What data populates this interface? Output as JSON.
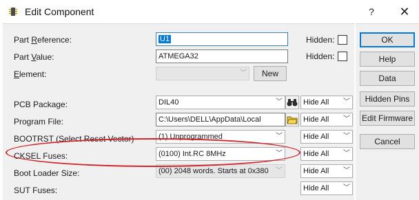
{
  "window": {
    "title": "Edit Component",
    "help_glyph": "?",
    "close_glyph": "✕"
  },
  "fields": [
    {
      "label_pre": "Part ",
      "label_key": "R",
      "label_post": "eference:",
      "value": "U1"
    },
    {
      "label_pre": "Part ",
      "label_key": "V",
      "label_post": "alue:",
      "value": "ATMEGA32"
    },
    {
      "label_pre": "",
      "label_key": "E",
      "label_post": "lement:",
      "value": ""
    }
  ],
  "hidden_label": "Hidden:",
  "new_button": "New",
  "properties": [
    {
      "label": "PCB Package:",
      "value": "DIL40",
      "visibility": "Hide All"
    },
    {
      "label": "Program File:",
      "value": "C:\\Users\\DELL\\AppData\\Local",
      "visibility": "Hide All"
    },
    {
      "label": "BOOTRST (Select Reset Vector)",
      "value": "(1) Unprogrammed",
      "visibility": "Hide All"
    },
    {
      "label": "CKSEL Fuses:",
      "value": "(0100) Int.RC 8MHz",
      "visibility": "Hide All"
    },
    {
      "label": "Boot Loader Size:",
      "value": "(00) 2048 words. Starts at 0x380",
      "visibility": "Hide All"
    },
    {
      "label": "SUT Fuses:",
      "value": "",
      "visibility": "Hide All"
    }
  ],
  "buttons": [
    "OK",
    "Help",
    "Data",
    "Hidden Pins",
    "Edit Firmware",
    "Cancel"
  ],
  "highlight_color": "#d0242b"
}
